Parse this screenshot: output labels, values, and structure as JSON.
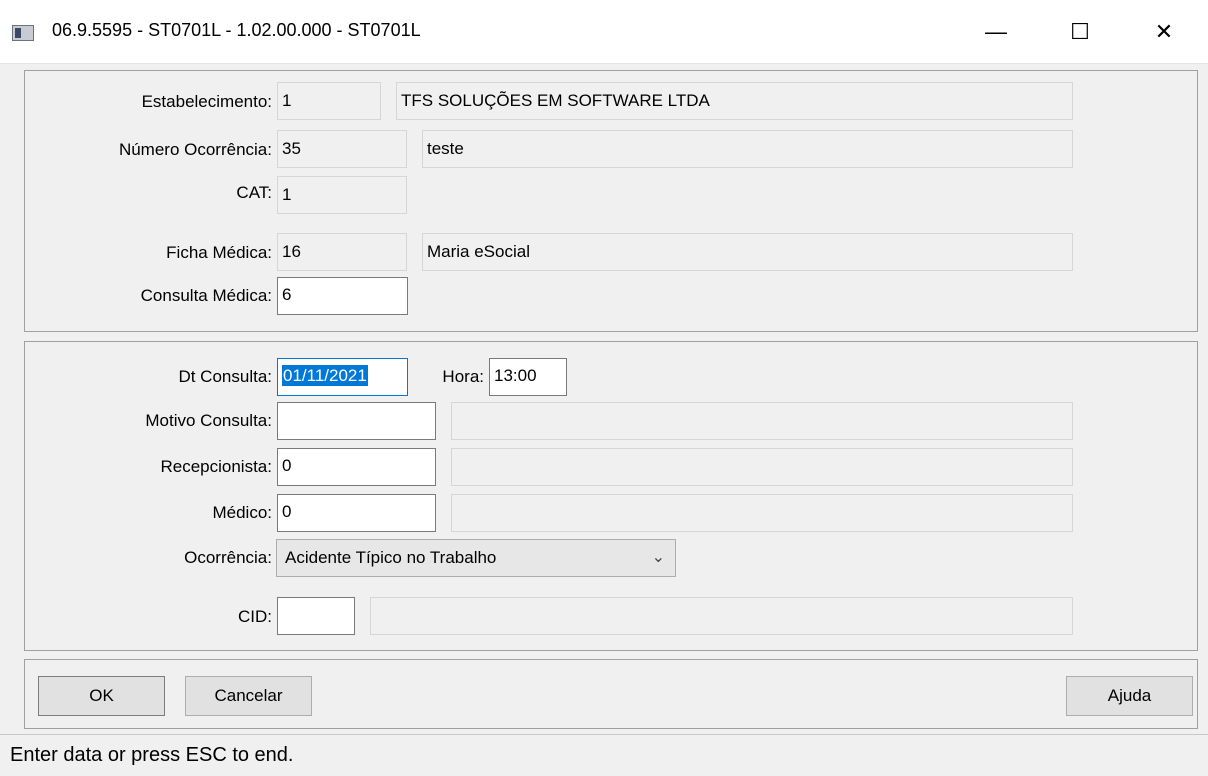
{
  "window": {
    "title": "06.9.5595 - ST0701L - 1.02.00.000 - ST0701L",
    "minimize_glyph": "—",
    "maximize_glyph": "☐",
    "close_glyph": "✕",
    "icon": "app-window-icon"
  },
  "header_group": {
    "estabelecimento": {
      "label": "Estabelecimento:",
      "code": "1",
      "description": "TFS SOLUÇÕES EM SOFTWARE LTDA"
    },
    "numero_ocorrencia": {
      "label": "Número Ocorrência:",
      "code": "35",
      "description": "teste"
    },
    "cat": {
      "label": "CAT:",
      "value": "1"
    },
    "ficha_medica": {
      "label": "Ficha Médica:",
      "code": "16",
      "description": "Maria eSocial"
    },
    "consulta_medica": {
      "label": "Consulta Médica:",
      "value": "6"
    }
  },
  "detail_group": {
    "dt_consulta": {
      "label": "Dt Consulta:",
      "value": "01/11/2021"
    },
    "hora": {
      "label": "Hora:",
      "value": "13:00"
    },
    "motivo_consulta": {
      "label": "Motivo Consulta:",
      "value": "",
      "description": ""
    },
    "recepcionista": {
      "label": "Recepcionista:",
      "value": "0",
      "description": ""
    },
    "medico": {
      "label": "Médico:",
      "value": "0",
      "description": ""
    },
    "ocorrencia": {
      "label": "Ocorrência:",
      "selected": "Acidente Típico no Trabalho"
    },
    "cid": {
      "label": "CID:",
      "value": "",
      "description": ""
    }
  },
  "buttons": {
    "ok": "OK",
    "cancel": "Cancelar",
    "help": "Ajuda"
  },
  "status": {
    "text": "Enter data or press ESC to end."
  },
  "colors": {
    "selection": "#0078d7",
    "background": "#f0f0f0"
  }
}
